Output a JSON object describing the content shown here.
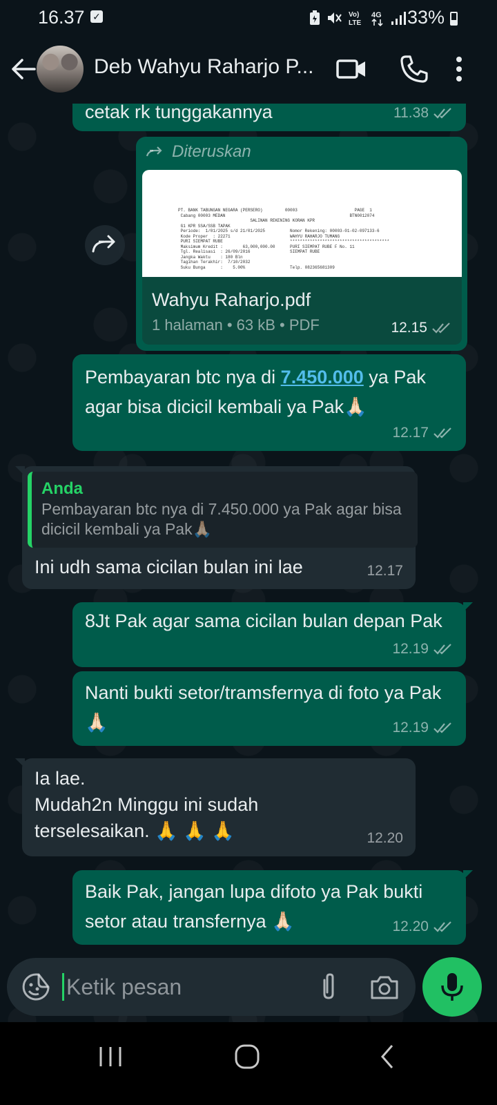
{
  "status_bar": {
    "time": "16.37",
    "battery": "33%",
    "network": "4G",
    "volte": "Vo) LTE"
  },
  "header": {
    "contact_name": "Deb Wahyu Raharjo P...",
    "icons": [
      "back-arrow-icon",
      "video-call-icon",
      "phone-icon",
      "more-vert-icon"
    ]
  },
  "messages": [
    {
      "type": "out",
      "text": "cetak rk tunggakannya",
      "time": "11.38"
    },
    {
      "type": "forwarded_doc",
      "forward_label": "Diteruskan",
      "file_name": "Wahyu Raharjo.pdf",
      "file_info": "1 halaman • 63 kB • PDF",
      "time": "12.15",
      "preview_lines": [
        "PT. BANK TABUNGAN NEGARA (PERSERO)         00003                       PAGE  1",
        " Cabang 00003 MEDAN                                                  BTN0012074",
        "                             SALINAN REKENING KORAN KPR",
        " G1 KPR SSA/SSB TAPAK",
        " Periode:  1/01/2025 s/d 21/01/2025          Nomor Rekening: 00003-01-02-097133-6",
        " Kode Proper  : 22271                        WAHYU RAHARJO TUMANG",
        " PURI SIEMPAT RUBE                           ****************************************",
        " Maksimum Kredit :        63,000,000.00      PURI SIEMPAT RUBE F No. 11",
        " Tgl. Realisasi  : 26/09/2016                SIEMPAT RUBE",
        " Jangka Waktu    : 180 Bln",
        " Tagihan Terakhir:  7/10/2032",
        " Suku Bunga      :    5.00%                  Telp. 082365681309"
      ]
    },
    {
      "type": "out",
      "text_before": "Pembayaran btc nya di ",
      "link": "7.450.000",
      "text_after": " ya Pak agar bisa dicicil kembali ya Pak🙏🏻",
      "time": "12.17"
    },
    {
      "type": "in",
      "quote_author": "Anda",
      "quote_text": "Pembayaran btc nya di 7.450.000 ya Pak agar bisa dicicil kembali ya Pak🙏🏻",
      "text": "Ini udh sama cicilan bulan ini lae",
      "time": "12.17"
    },
    {
      "type": "out",
      "text": "8Jt Pak agar sama cicilan bulan depan Pak",
      "time": "12.19"
    },
    {
      "type": "out",
      "text": "Nanti bukti setor/tramsfernya di foto ya Pak🙏🏻",
      "time": "12.19"
    },
    {
      "type": "in",
      "line1": "Ia lae.",
      "line2": "Mudah2n Minggu ini sudah",
      "line3": "terselesaikan. 🙏 🙏 🙏",
      "time": "12.20"
    },
    {
      "type": "out",
      "text": "Baik Pak, jangan lupa difoto ya Pak bukti setor atau transfernya 🙏🏻",
      "time": "12.20"
    }
  ],
  "input": {
    "placeholder": "Ketik pesan"
  },
  "colors": {
    "background": "#0b141a",
    "outgoing_bubble": "#005c4b",
    "incoming_bubble": "#202c33",
    "accent_green": "#25d366",
    "link_blue": "#53bdeb"
  }
}
